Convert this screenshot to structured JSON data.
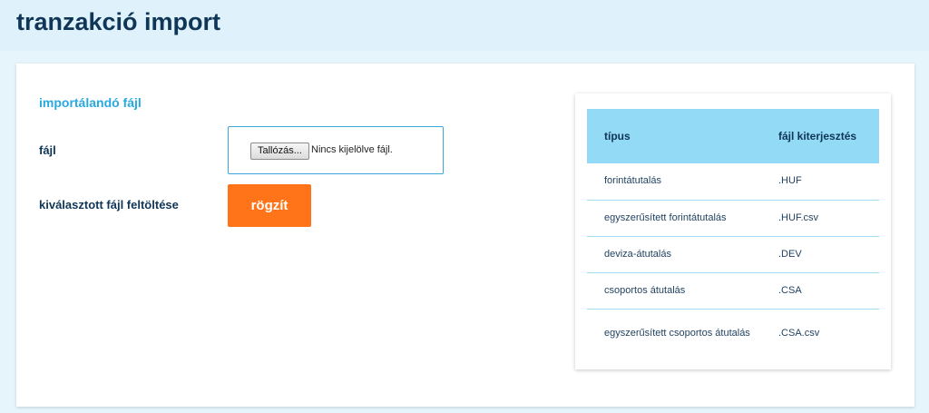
{
  "header": {
    "title": "tranzakció import"
  },
  "form": {
    "section_title": "importálandó fájl",
    "file_label": "fájl",
    "browse_label": "Tallózás...",
    "no_file_text": "Nincs kijelölve fájl.",
    "upload_label": "kiválasztott fájl feltöltése",
    "submit_label": "rögzít"
  },
  "types_table": {
    "headers": {
      "type": "típus",
      "extension": "fájl kiterjesztés"
    },
    "rows": [
      {
        "type": "forintátutalás",
        "extension": ".HUF"
      },
      {
        "type": "egyszerűsített forintátutalás",
        "extension": ".HUF.csv"
      },
      {
        "type": "deviza-átutalás",
        "extension": ".DEV"
      },
      {
        "type": "csoportos átutalás",
        "extension": ".CSA"
      },
      {
        "type": "egyszerűsített csoportos átutalás",
        "extension": ".CSA.csv"
      }
    ]
  },
  "colors": {
    "accent": "#29a8e0",
    "primary_text": "#0f3557",
    "submit_button": "#ff7419",
    "table_header": "#92daf6",
    "header_background": "#dff2fb"
  }
}
